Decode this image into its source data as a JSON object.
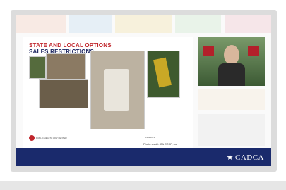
{
  "slide": {
    "title": "STATE AND LOCAL OPTIONS",
    "subtitle": "SALES RESTRICTIONS",
    "photo_credit": "Photo credit: CA CTCP, me",
    "page_marker": "11/9/2021",
    "logo_text": "PUBLIC HEALTH LAW CENTER"
  },
  "footer": {
    "brand": "CADCA"
  },
  "colors": {
    "title_red": "#c0262c",
    "title_navy": "#1d2660",
    "footer_navy": "#1a2a6c"
  }
}
